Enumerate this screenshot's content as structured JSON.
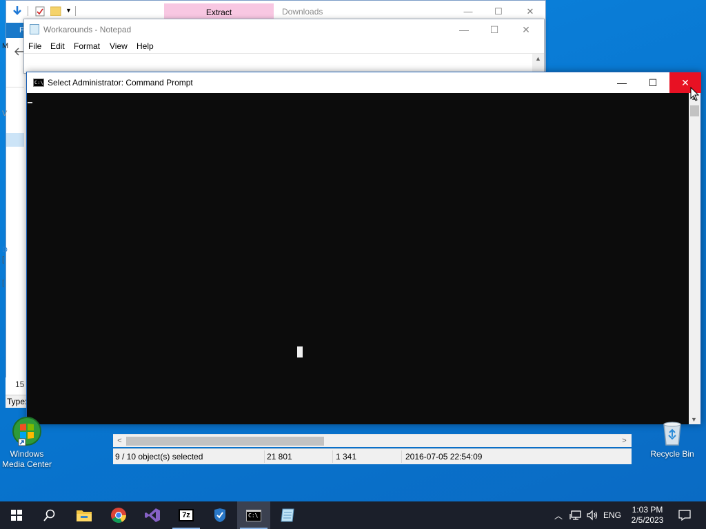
{
  "explorer": {
    "extract_tab": "Extract",
    "title": "Downloads",
    "ribbon_file_letter": "F",
    "partial_letters": [
      "M",
      "V",
      "D"
    ],
    "left_number": "15",
    "type_label": "Type:",
    "status": {
      "selected": "9 / 10 object(s) selected",
      "size": "21 801",
      "packed": "1 341",
      "modified": "2016-07-05 22:54:09"
    }
  },
  "notepad": {
    "title": "Workarounds - Notepad",
    "menu": [
      "File",
      "Edit",
      "Format",
      "View",
      "Help"
    ]
  },
  "cmd": {
    "title": "Select Administrator:  Command Prompt",
    "icon_text": "C:\\"
  },
  "desktop": {
    "icons": [
      {
        "label_line1": "Windows",
        "label_line2": "Media Center"
      },
      {
        "label_line1": "Recycle Bin",
        "label_line2": ""
      }
    ]
  },
  "taskbar": {
    "apps": [
      "start-icon",
      "search-icon",
      "file-explorer-icon",
      "chrome-icon",
      "visual-studio-icon",
      "7zip-icon",
      "shield-app-icon",
      "command-prompt-icon",
      "notepad-icon"
    ],
    "language": "ENG",
    "time": "1:03 PM",
    "date": "2/5/2023"
  },
  "colors": {
    "desktop": "#0a7cd6",
    "close_red": "#e81123",
    "taskbar": "#1b1f2a",
    "extract_pink": "#f8c7e2"
  }
}
